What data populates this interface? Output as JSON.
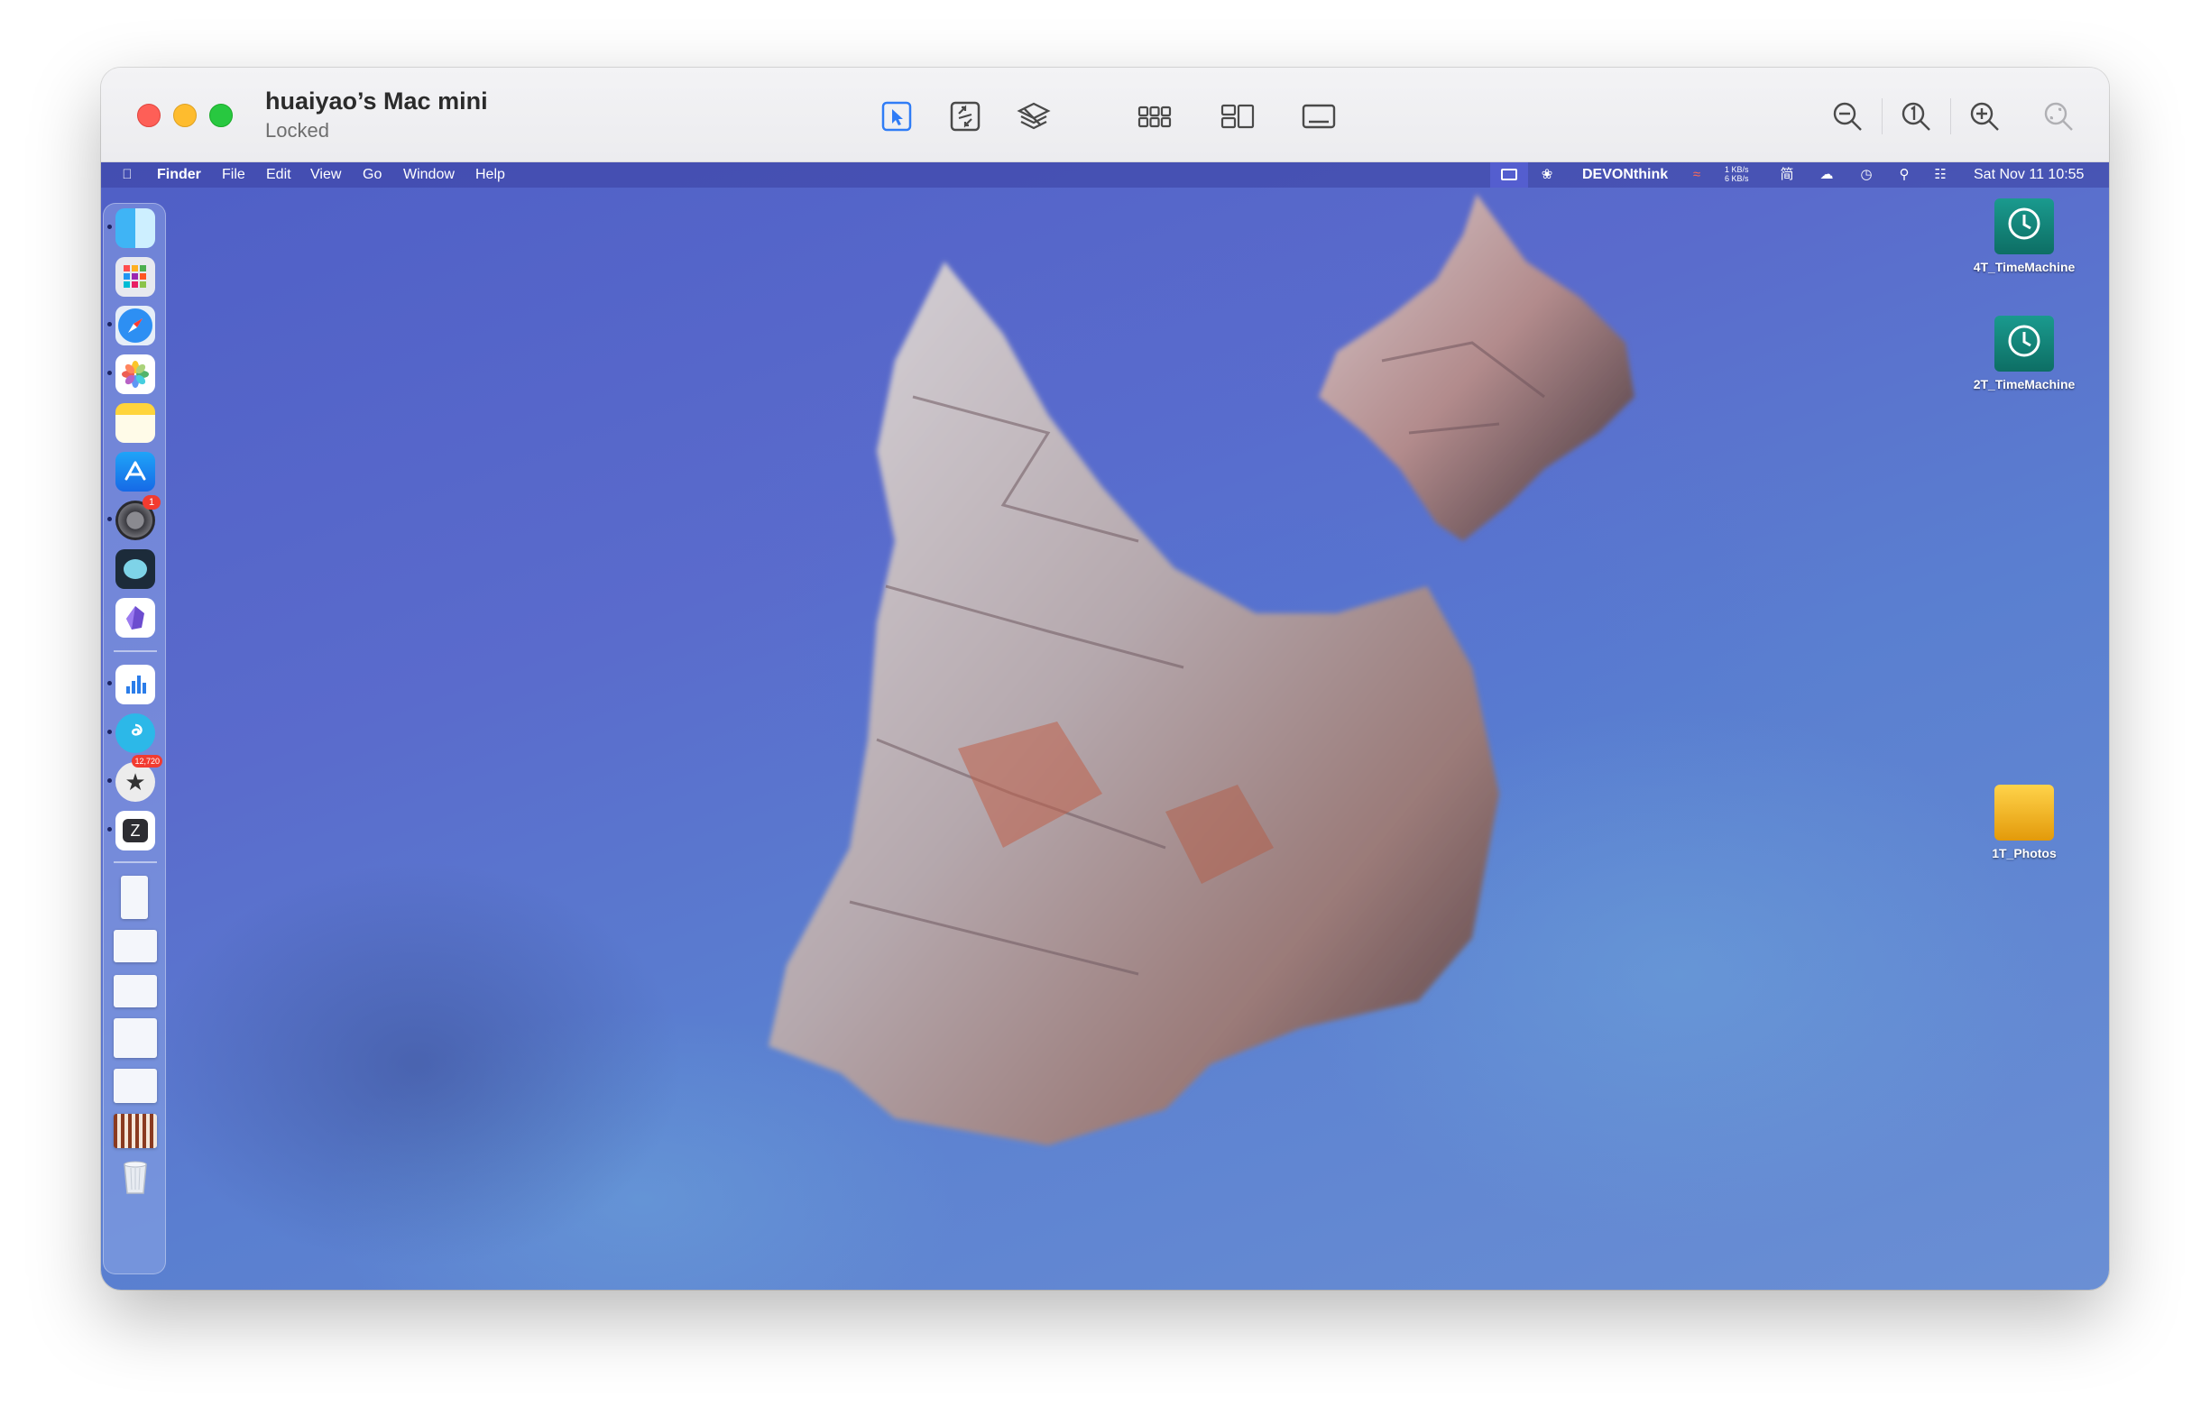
{
  "window": {
    "title": "huaiyao’s Mac mini",
    "status": "Locked"
  },
  "toolbar": {
    "tools": [
      "pointer-icon",
      "scale-icon",
      "layers-icon",
      "grid-icon",
      "split-view-icon",
      "bottom-panel-icon"
    ],
    "zoom": [
      "zoom-out-icon",
      "actual-size-icon",
      "zoom-in-icon",
      "zoom-fit-icon"
    ]
  },
  "menubar": {
    "app": "Finder",
    "items": [
      "File",
      "Edit",
      "View",
      "Go",
      "Window",
      "Help"
    ],
    "devonthink": "DEVONthink",
    "net_up": "1 KB/s",
    "net_down": "6 KB/s",
    "clock": "Sat Nov 11  10:55"
  },
  "dock": {
    "system_settings_badge": "1",
    "reeder_badge": "12,720"
  },
  "desktop": {
    "icons": [
      {
        "label": "4T_TimeMachine"
      },
      {
        "label": "2T_TimeMachine"
      },
      {
        "label": "1T_Photos"
      }
    ]
  },
  "colors": {
    "accent": "#2f7cf6",
    "close": "#fe5f57",
    "minimize": "#febc2e",
    "maximize": "#28c840",
    "desktop_blue": "#5565c8"
  }
}
